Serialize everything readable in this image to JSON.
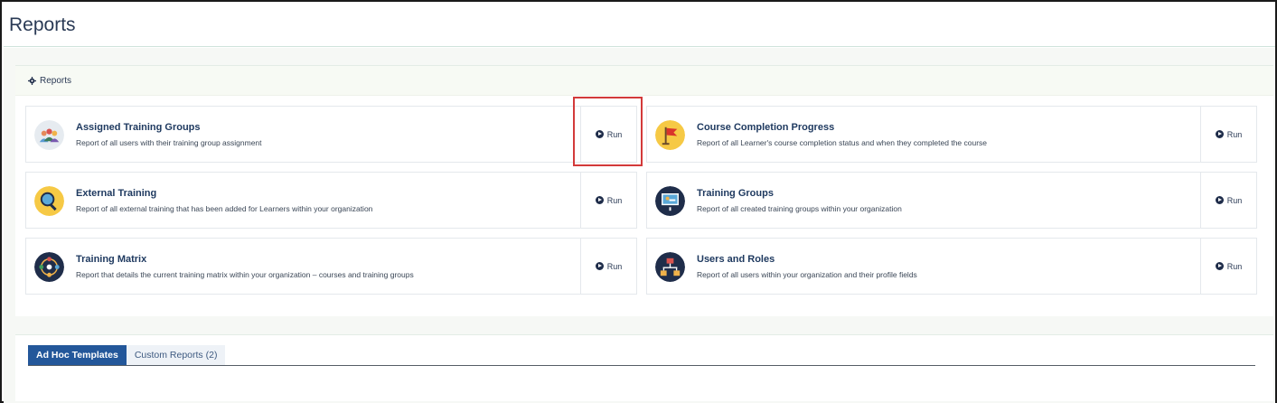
{
  "page": {
    "title": "Reports"
  },
  "panel": {
    "heading": "Reports"
  },
  "reports": [
    {
      "title": "Assigned Training Groups",
      "description": "Report of all users with their training group assignment",
      "run_label": "Run",
      "icon": "people-group-icon"
    },
    {
      "title": "Course Completion Progress",
      "description": "Report of all Learner's course completion status and when they completed the course",
      "run_label": "Run",
      "icon": "flag-icon"
    },
    {
      "title": "External Training",
      "description": "Report of all external training that has been added for Learners within your organization",
      "run_label": "Run",
      "icon": "magnifier-icon"
    },
    {
      "title": "Training Groups",
      "description": "Report of all created training groups within your organization",
      "run_label": "Run",
      "icon": "presentation-board-icon"
    },
    {
      "title": "Training Matrix",
      "description": "Report that details the current training matrix within your organization – courses and training groups",
      "run_label": "Run",
      "icon": "network-matrix-icon"
    },
    {
      "title": "Users and Roles",
      "description": "Report of all users within your organization and their profile fields",
      "run_label": "Run",
      "icon": "org-chart-icon"
    }
  ],
  "tabs": [
    {
      "label": "Ad Hoc Templates",
      "active": true
    },
    {
      "label": "Custom Reports (2)",
      "active": false
    }
  ],
  "colors": {
    "accent": "#23579a",
    "highlight": "#d33a3a",
    "title_text": "#1f3a60"
  }
}
